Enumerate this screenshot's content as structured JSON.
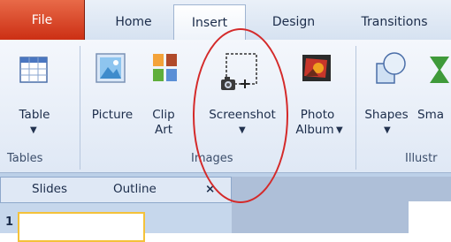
{
  "tabs": {
    "file": "File",
    "home": "Home",
    "insert": "Insert",
    "design": "Design",
    "transitions": "Transitions"
  },
  "ribbon": {
    "table": "Table",
    "picture": "Picture",
    "clip_art_1": "Clip",
    "clip_art_2": "Art",
    "screenshot": "Screenshot",
    "photo_album_1": "Photo",
    "photo_album_2": "Album",
    "shapes": "Shapes",
    "smartart_partial": "Sma",
    "groups": {
      "tables": "Tables",
      "images": "Images",
      "illustrations_partial": "Illustr"
    }
  },
  "panes": {
    "slides_tab": "Slides",
    "outline_tab": "Outline",
    "close_glyph": "×",
    "slide_number": "1"
  },
  "colors": {
    "file_tab": "#cc2f14",
    "annotation_ellipse": "#d42a2a",
    "ribbon_bg": "#dfe8f5"
  }
}
